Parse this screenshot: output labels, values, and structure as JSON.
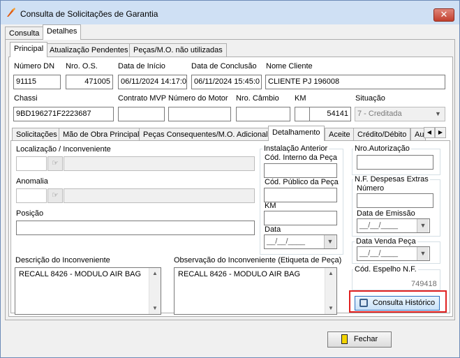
{
  "window": {
    "title": "Consulta de Solicitações de Garantia",
    "close_label": "✕"
  },
  "top_tabs": [
    {
      "label": "Consulta",
      "active": false
    },
    {
      "label": "Detalhes",
      "active": true
    }
  ],
  "sub_tabs": [
    {
      "label": "Principal",
      "active": true
    },
    {
      "label": "Atualização Pendentes",
      "active": false
    },
    {
      "label": "Peças/M.O. não utilizadas",
      "active": false
    }
  ],
  "header_fields": {
    "numero_dn": {
      "label": "Número DN",
      "value": "91115"
    },
    "nro_os": {
      "label": "Nro. O.S.",
      "value": "471005"
    },
    "data_inicio": {
      "label": "Data de Início",
      "value": "06/11/2024 14:17:0"
    },
    "data_conclusao": {
      "label": "Data de Conclusão",
      "value": "06/11/2024 15:45:0"
    },
    "nome_cliente": {
      "label": "Nome Cliente",
      "value": "CLIENTE PJ 196008"
    },
    "chassi": {
      "label": "Chassi",
      "value": "9BD196271F2223687"
    },
    "contrato_mvp": {
      "label": "Contrato MVP",
      "value": ""
    },
    "numero_motor": {
      "label": "Número do Motor",
      "value": ""
    },
    "nro_cambio": {
      "label": "Nro. Câmbio",
      "value": ""
    },
    "km": {
      "label": "KM",
      "value": "54141"
    },
    "situacao": {
      "label": "Situação",
      "value": "7 - Creditada"
    }
  },
  "detail_tabs": [
    {
      "label": "Solicitações",
      "active": false
    },
    {
      "label": "Mão de Obra Principal",
      "active": false
    },
    {
      "label": "Peças Consequentes/M.O. Adicional",
      "active": false
    },
    {
      "label": "Detalhamento",
      "active": true
    },
    {
      "label": "Aceite",
      "active": false
    },
    {
      "label": "Crédito/Débito",
      "active": false
    },
    {
      "label": "Au",
      "active": false
    }
  ],
  "detalhamento": {
    "localizacao_label": "Localização / Inconveniente",
    "anomalia_label": "Anomalia",
    "posicao_label": "Posição",
    "instalacao_anterior": {
      "title": "Instalação Anterior",
      "cod_interno_label": "Cód. Interno da Peça",
      "cod_publico_label": "Cód. Público da Peça",
      "km_label": "KM",
      "data_label": "Data",
      "data_value": "__/__/____"
    },
    "nro_autorizacao_label": "Nro.Autorização",
    "nf_despesas": {
      "title": "N.F. Despesas Extras",
      "numero_label": "Número",
      "data_emissao_label": "Data de Emissão",
      "data_emissao_value": "__/__/____"
    },
    "data_venda_label": "Data Venda Peça",
    "data_venda_value": "__/__/____",
    "cod_espelho_label": "Cód. Espelho N.F.",
    "cod_espelho_value": "749418",
    "descricao_label": "Descrição do Inconveniente",
    "descricao_value": "RECALL 8426 - MODULO AIR BAG",
    "observacao_label": "Observação do Inconveniente (Etiqueta de Peça)",
    "observacao_value": "RECALL 8426 - MODULO AIR BAG",
    "consulta_historico_label": "Consulta Histórico"
  },
  "footer": {
    "fechar_label": "Fechar"
  },
  "colors": {
    "highlight_box": "#e02020",
    "title_bar": "#cfe0f4"
  }
}
